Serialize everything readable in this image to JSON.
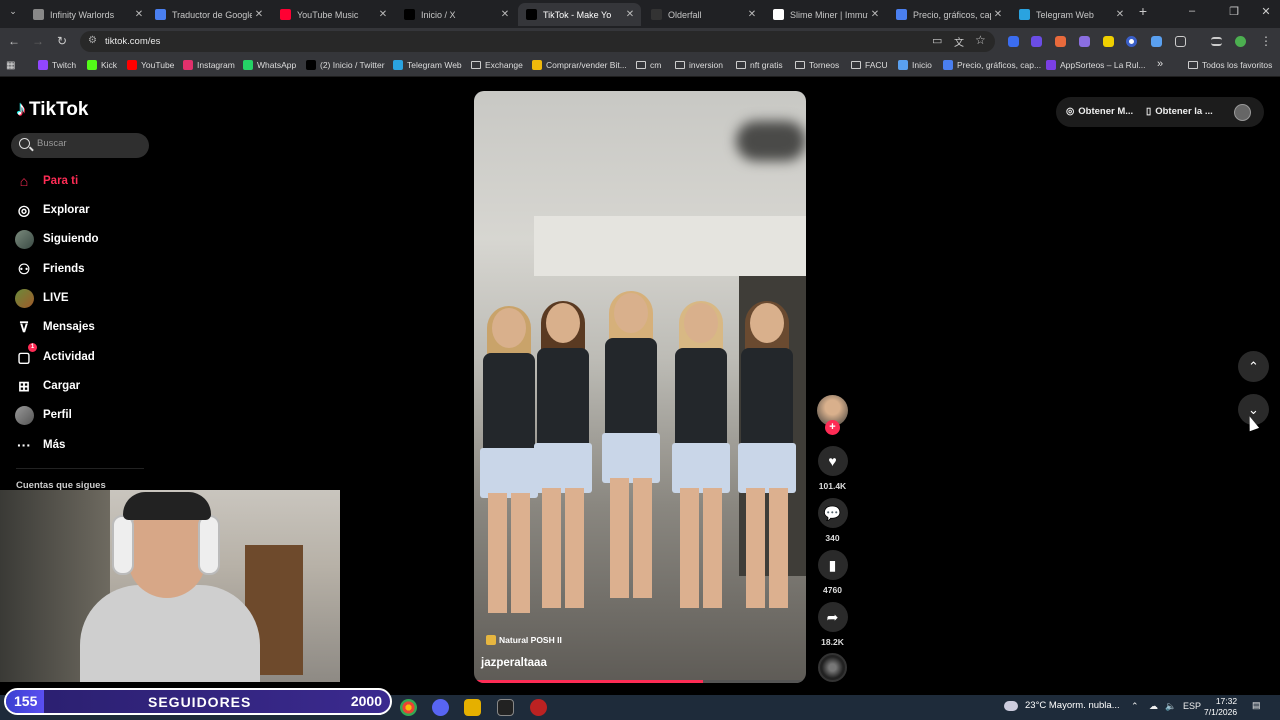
{
  "browser": {
    "tabs": [
      {
        "title": "Infinity Warlords",
        "active": false
      },
      {
        "title": "Traductor de Google",
        "active": false
      },
      {
        "title": "YouTube Music",
        "active": false
      },
      {
        "title": "Inicio / X",
        "active": false
      },
      {
        "title": "TikTok - Make Yo",
        "active": true
      },
      {
        "title": "Olderfall",
        "active": false
      },
      {
        "title": "Slime Miner | Immuta",
        "active": false
      },
      {
        "title": "Precio, gráficos, capi",
        "active": false
      },
      {
        "title": "Telegram Web",
        "active": false
      }
    ],
    "url": "tiktok.com/es",
    "bookmarks": [
      "Twitch",
      "Kick",
      "YouTube",
      "Instagram",
      "WhatsApp",
      "(2) Inicio / Twitter",
      "Telegram Web",
      "Exchange",
      "Comprar/vender Bit...",
      "cm",
      "inversion",
      "nft gratis",
      "Torneos",
      "FACU",
      "Inicio",
      "Precio, gráficos, cap...",
      "AppSorteos – La Rul..."
    ],
    "all_bookmarks": "Todos los favoritos"
  },
  "tiktok": {
    "logo": "TikTok",
    "search_placeholder": "Buscar",
    "nav": [
      {
        "label": "Para ti",
        "icon": "home-icon"
      },
      {
        "label": "Explorar",
        "icon": "compass-icon"
      },
      {
        "label": "Siguiendo",
        "icon": "following-avatar-icon"
      },
      {
        "label": "Friends",
        "icon": "friends-icon"
      },
      {
        "label": "LIVE",
        "icon": "live-icon"
      },
      {
        "label": "Mensajes",
        "icon": "messages-icon"
      },
      {
        "label": "Actividad",
        "icon": "activity-icon",
        "badge": "1"
      },
      {
        "label": "Cargar",
        "icon": "upload-icon"
      },
      {
        "label": "Perfil",
        "icon": "profile-icon"
      },
      {
        "label": "Más",
        "icon": "more-icon"
      }
    ],
    "following_header": "Cuentas que sigues",
    "video": {
      "author": "jazperaltaaa",
      "music": "Natural POSH II",
      "progress": 0.69
    },
    "actions": {
      "likes": "101.4K",
      "comments": "340",
      "saves": "4760",
      "shares": "18.2K"
    },
    "top_right": {
      "coins": "Obtener M...",
      "app": "Obtener la ..."
    }
  },
  "overlay": {
    "followers_current": "155",
    "followers_label": "SEGUIDORES",
    "followers_goal": "2000",
    "followers_progress": 0.0775
  },
  "taskbar": {
    "weather": "23°C  Mayorm. nubla...",
    "lang": "ESP",
    "time": "17:32",
    "date": "7/1/2026"
  }
}
